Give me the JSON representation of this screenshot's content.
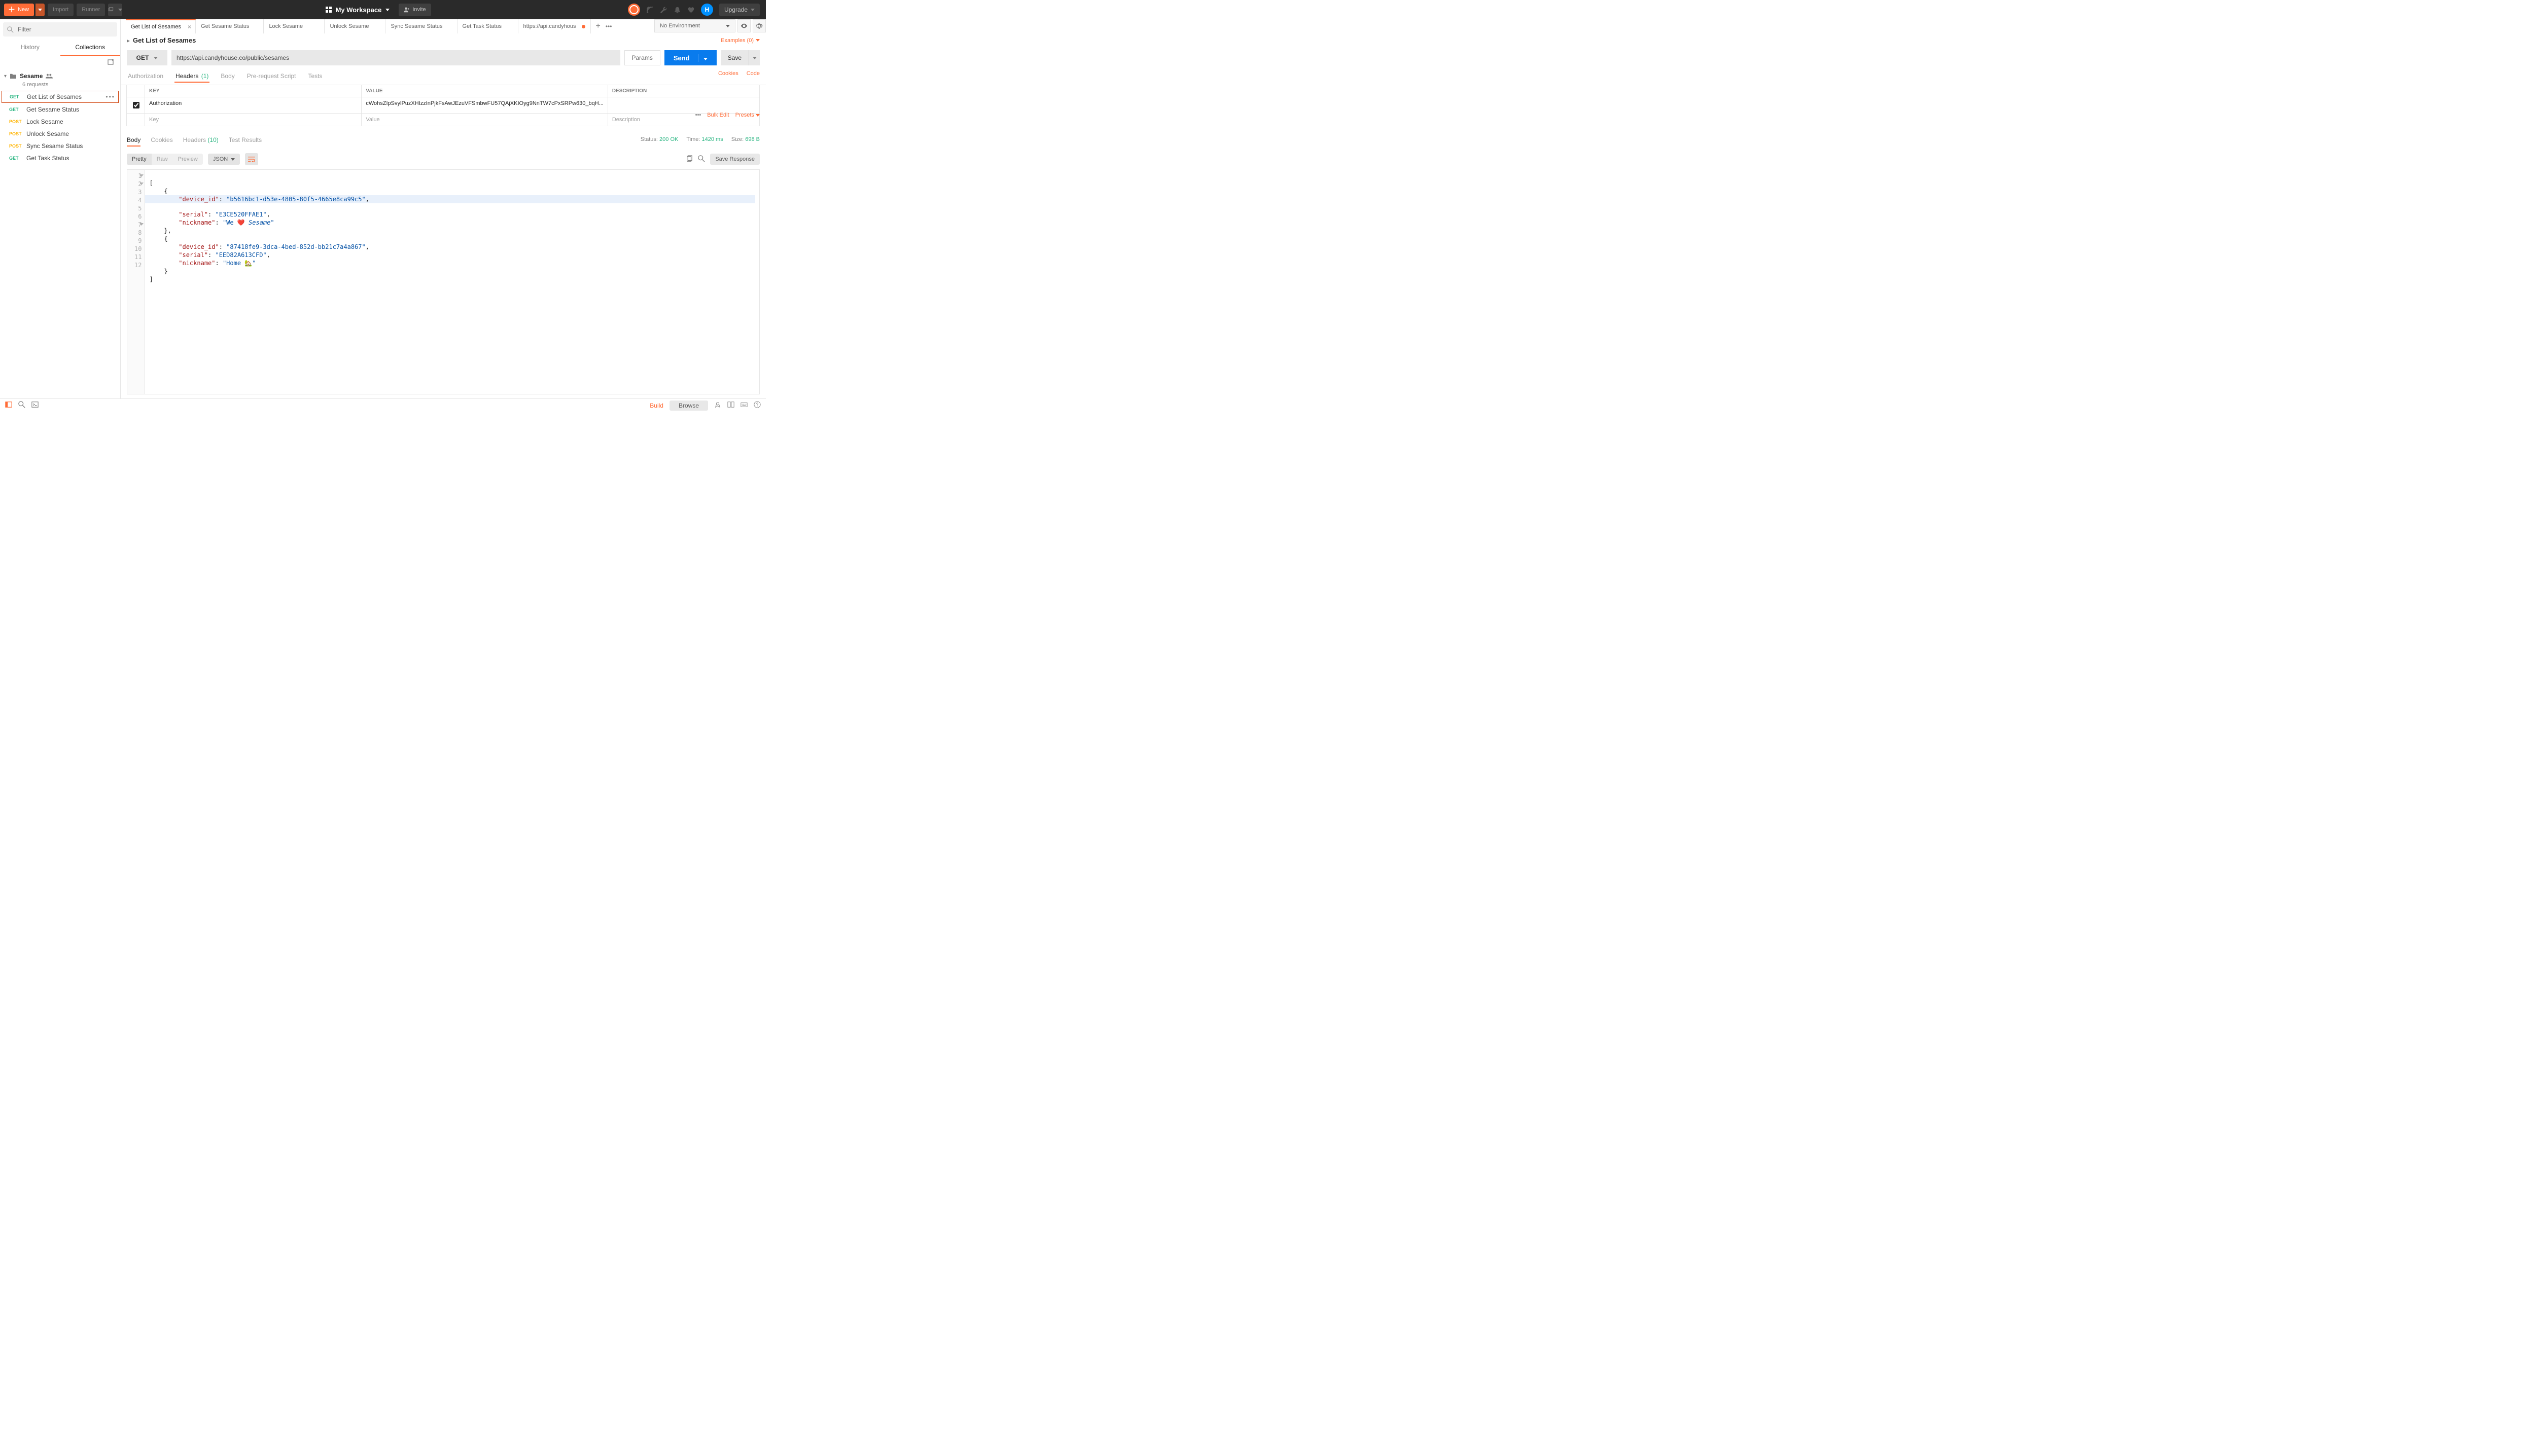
{
  "topbar": {
    "new_label": "New",
    "import_label": "Import",
    "runner_label": "Runner",
    "workspace_label": "My Workspace",
    "invite_label": "Invite",
    "avatar_letter": "H",
    "upgrade_label": "Upgrade"
  },
  "sidebar": {
    "filter_placeholder": "Filter",
    "tabs": {
      "history": "History",
      "collections": "Collections"
    },
    "collection": {
      "name": "Sesame",
      "meta": "6 requests"
    },
    "requests": [
      {
        "method": "GET",
        "name": "Get List of Sesames",
        "active": true
      },
      {
        "method": "GET",
        "name": "Get Sesame Status"
      },
      {
        "method": "POST",
        "name": "Lock Sesame"
      },
      {
        "method": "POST",
        "name": "Unlock Sesame"
      },
      {
        "method": "POST",
        "name": "Sync Sesame Status"
      },
      {
        "method": "GET",
        "name": "Get Task Status"
      }
    ]
  },
  "tabs": [
    {
      "label": "Get List of Sesames",
      "active": true,
      "closable": true
    },
    {
      "label": "Get Sesame Status"
    },
    {
      "label": "Lock Sesame"
    },
    {
      "label": "Unlock Sesame"
    },
    {
      "label": "Sync Sesame Status"
    },
    {
      "label": "Get Task Status"
    },
    {
      "label": "https://api.candyhous",
      "dirty": true
    }
  ],
  "environment": {
    "label": "No Environment"
  },
  "breadcrumb": {
    "title": "Get List of Sesames",
    "examples": "Examples (0)"
  },
  "request": {
    "method": "GET",
    "url": "https://api.candyhouse.co/public/sesames",
    "params_btn": "Params",
    "send_btn": "Send",
    "save_btn": "Save"
  },
  "req_tabs": {
    "authorization": "Authorization",
    "headers": "Headers",
    "headers_count": "(1)",
    "body": "Body",
    "prerequest": "Pre-request Script",
    "tests": "Tests",
    "cookies": "Cookies",
    "code": "Code"
  },
  "headers_table": {
    "cols": {
      "key": "KEY",
      "value": "VALUE",
      "desc": "DESCRIPTION"
    },
    "row": {
      "key": "Authorization",
      "value": "cWohsZIpSvylPuzXHIzzInPjkFsAwJEzuVFSmbwFU57QAjXKIOyg9NnTW7cPxSRPw630_bqH...",
      "desc": ""
    },
    "placeholders": {
      "key": "Key",
      "value": "Value",
      "desc": "Description"
    },
    "bulk_edit": "Bulk Edit",
    "presets": "Presets"
  },
  "response": {
    "tabs": {
      "body": "Body",
      "cookies": "Cookies",
      "headers": "Headers",
      "headers_count": "(10)",
      "tests": "Test Results"
    },
    "status_label": "Status:",
    "status_value": "200 OK",
    "time_label": "Time:",
    "time_value": "1420 ms",
    "size_label": "Size:",
    "size_value": "698 B",
    "format": {
      "pretty": "Pretty",
      "raw": "Raw",
      "preview": "Preview",
      "json": "JSON"
    },
    "save_response": "Save Response",
    "json_lines": [
      "[",
      "    {",
      "        \"device_id\": \"b5616bc1-d53e-4805-80f5-4665e8ca99c5\",",
      "        \"serial\": \"E3CE520FFAE1\",",
      "        \"nickname\": \"We ❤️ Sesame\"",
      "    },",
      "    {",
      "        \"device_id\": \"87418fe9-3dca-4bed-852d-bb21c7a4a867\",",
      "        \"serial\": \"EED82A613CFD\",",
      "        \"nickname\": \"Home 🏡\"",
      "    }",
      "]"
    ]
  },
  "footer": {
    "build": "Build",
    "browse": "Browse"
  }
}
